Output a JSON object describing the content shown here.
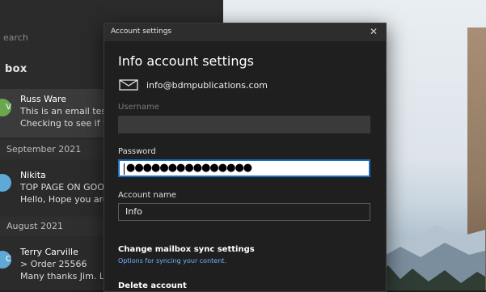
{
  "mail_list": {
    "search_placeholder": "earch",
    "folder_name": "box",
    "messages": [
      {
        "from": "Russ Ware",
        "line1": "This is an email test!",
        "line2": "Checking to see if th",
        "initial": "V"
      },
      {
        "from": "Nikita",
        "line1": "TOP PAGE ON GOOG",
        "line2": "Hello, Hope you are",
        "initial": ""
      },
      {
        "from": "Terry Carville",
        "line1": "> Order 25566",
        "line2": "Many thanks Jim. Lo",
        "initial": "C"
      }
    ],
    "groups": [
      "September 2021",
      "August 2021"
    ]
  },
  "dialog": {
    "window_title": "Account settings",
    "close_glyph": "✕",
    "heading": "Info account settings",
    "email": "info@bdmpublications.com",
    "username_label": "Username",
    "username_value": "",
    "password_label": "Password",
    "password_value": "●●●●●●●●●●●●●●●",
    "account_name_label": "Account name",
    "account_name_value": "Info",
    "sync_title": "Change mailbox sync settings",
    "sync_link": "Options for syncing your content.",
    "delete_title": "Delete account"
  }
}
